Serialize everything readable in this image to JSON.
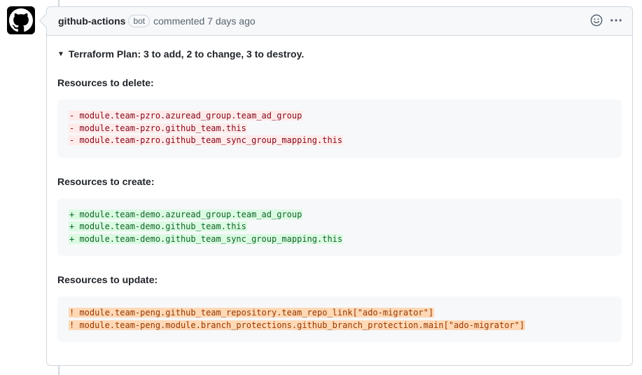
{
  "comment": {
    "author": "github-actions",
    "badge": "bot",
    "meta": "commented 7 days ago"
  },
  "summary": "Terraform Plan: 3 to add, 2 to change, 3 to destroy.",
  "sections": {
    "delete": {
      "heading": "Resources to delete:",
      "lines": [
        "- module.team-pzro.azuread_group.team_ad_group",
        "- module.team-pzro.github_team.this",
        "- module.team-pzro.github_team_sync_group_mapping.this"
      ]
    },
    "create": {
      "heading": "Resources to create:",
      "lines": [
        "+ module.team-demo.azuread_group.team_ad_group",
        "+ module.team-demo.github_team.this",
        "+ module.team-demo.github_team_sync_group_mapping.this"
      ]
    },
    "update": {
      "heading": "Resources to update:",
      "lines": [
        "! module.team-peng.github_team_repository.team_repo_link[\"ado-migrator\"]",
        "! module.team-peng.module.branch_protections.github_branch_protection.main[\"ado-migrator\"]"
      ]
    }
  },
  "icons": {
    "avatar": "github-logo-icon",
    "emoji": "smiley-icon",
    "more": "kebab-horizontal-icon",
    "disclosure": "triangle-down-icon"
  },
  "colors": {
    "delete_bg": "#ffebe9",
    "add_bg": "#dafbe1",
    "update_bg": "#ffd8b5"
  }
}
